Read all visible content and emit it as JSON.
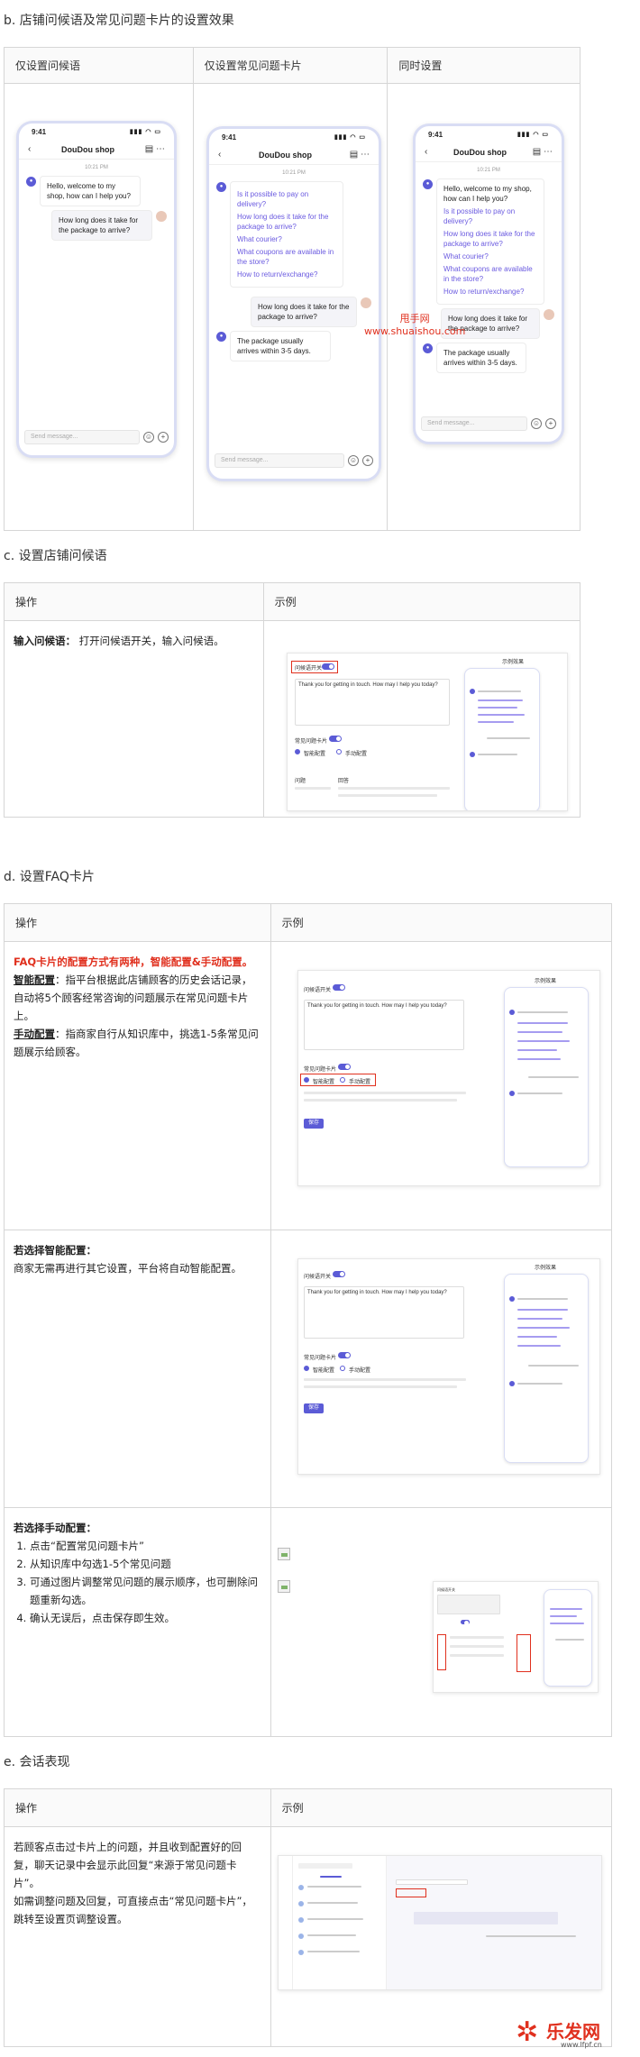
{
  "sections": {
    "b": {
      "title": "b. 店铺问候语及常见问题卡片的设置效果",
      "cols": [
        "仅设置问候语",
        "仅设置常见问题卡片",
        "同时设置"
      ]
    },
    "c": {
      "title": "c. 设置店铺问候语",
      "op": "操作",
      "ex": "示例",
      "row_label": "输入问候语：",
      "row_text": "打开问候语开关，输入问候语。"
    },
    "d": {
      "title": "d. 设置FAQ卡片",
      "op": "操作",
      "ex": "示例",
      "r1_red": "FAQ卡片的配置方式有两种，智能配置&手动配置。",
      "r1_smart_label": "智能配置",
      "r1_smart_text": "：指平台根据此店铺顾客的历史会话记录，自动将5个顾客经常咨询的问题展示在常见问题卡片上。",
      "r1_manual_label": "手动配置",
      "r1_manual_text": "：指商家自行从知识库中，挑选1-5条常见问题展示给顾客。",
      "r2_title": "若选择智能配置：",
      "r2_text": "商家无需再进行其它设置，平台将自动智能配置。",
      "r3_title": "若选择手动配置：",
      "r3_steps": [
        "点击“配置常见问题卡片”",
        "从知识库中勾选1-5个常见问题",
        "可通过图片调整常见问题的展示顺序，也可删除问题重新勾选。",
        "确认无误后，点击保存即生效。"
      ]
    },
    "e": {
      "title": "e. 会话表现",
      "op": "操作",
      "ex": "示例",
      "text1": "若顾客点击过卡片上的问题，并且收到配置好的回复，聊天记录中会显示此回复“来源于常见问题卡片”。",
      "text2": "如需调整问题及回复，可直接点击“常见问题卡片”，跳转至设置页调整设置。"
    }
  },
  "phone": {
    "time": "9:41",
    "shop": "DouDou shop",
    "stamp": "10:21 PM",
    "greeting": "Hello, welcome to my shop, how can I help you?",
    "question": "How long does it take for the package to arrive?",
    "answer": "The package usually arrives within 3-5 days.",
    "faq": [
      "Is it possible to pay on delivery?",
      "How long does it take for the package to arrive?",
      "What courier?",
      "What coupons are available in the store?",
      "How to return/exchange?"
    ],
    "input_placeholder": "Send message..."
  },
  "watermark": {
    "line1": "甩手网",
    "line2": "www.shuaishou.com"
  },
  "mini": {
    "greet_switch": "问候语开关",
    "greet_text": "Thank you for getting in touch. How may I help you today?",
    "faq_switch": "常见问题卡片",
    "smart": "智能配置",
    "manual": "手动配置",
    "result": "示例效果",
    "save": "保存",
    "col_q": "问题",
    "col_a": "回答"
  },
  "logo": {
    "name": "乐发网",
    "url": "www.lfpf.cn"
  }
}
